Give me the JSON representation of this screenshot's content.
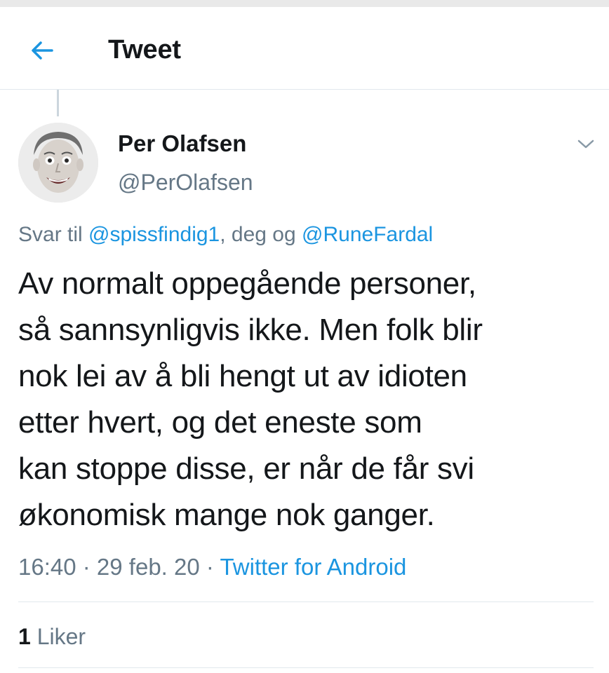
{
  "header": {
    "title": "Tweet",
    "back_icon": "arrow-left-icon",
    "accent_color": "#1b95e0"
  },
  "author": {
    "name": "Per Olafsen",
    "handle": "@PerOlafsen",
    "avatar_icon": "avatar-photo",
    "menu_icon": "chevron-down-icon"
  },
  "reply": {
    "prefix": "Svar til ",
    "mention_1": "@spissfindig1",
    "middle": ", deg og ",
    "mention_2": "@RuneFardal"
  },
  "tweet": {
    "lines": [
      "Av normalt oppegående personer,",
      "så sannsynligvis ikke. Men folk blir",
      "nok lei av å bli hengt ut av idioten",
      "etter hvert, og det eneste som",
      "kan stoppe disse, er når de får svi",
      "økonomisk mange nok ganger."
    ]
  },
  "meta": {
    "time": "16:40",
    "separator": " · ",
    "date": "29 feb. 20",
    "source": "Twitter for Android"
  },
  "stats": {
    "likes_count": "1",
    "likes_label": " Liker"
  }
}
